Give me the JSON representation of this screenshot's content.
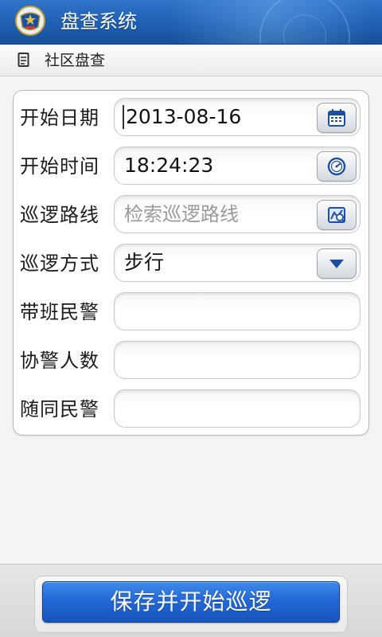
{
  "app": {
    "title": "盘查系统",
    "accent_color": "#1f5fb3",
    "emblem_icon": "police-emblem-icon"
  },
  "breadcrumb": {
    "icon": "document-icon",
    "label": "社区盘查"
  },
  "form": {
    "start_date": {
      "label": "开始日期",
      "value": "2013-08-16",
      "button_icon": "calendar-icon"
    },
    "start_time": {
      "label": "开始时间",
      "value": "18:24:23",
      "button_icon": "clock-icon"
    },
    "patrol_route": {
      "label": "巡逻路线",
      "value": "",
      "placeholder": "检索巡逻路线",
      "button_icon": "route-map-icon"
    },
    "patrol_mode": {
      "label": "巡逻方式",
      "value": "步行",
      "button_icon": "dropdown-arrow-icon"
    },
    "duty_officer": {
      "label": "带班民警",
      "value": ""
    },
    "auxiliary_count": {
      "label": "协警人数",
      "value": ""
    },
    "accompanying_officer": {
      "label": "随同民警",
      "value": ""
    }
  },
  "footer": {
    "save_button_label": "保存并开始巡逻",
    "button_color": "#2368d6"
  }
}
